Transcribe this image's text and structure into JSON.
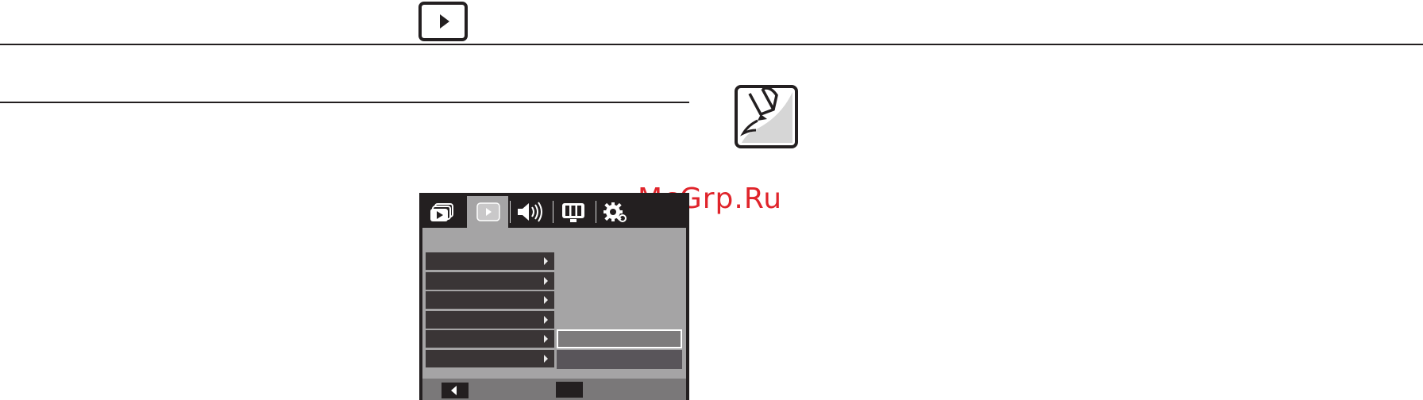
{
  "header": {
    "mode_icon": "play-icon"
  },
  "note": {
    "icon": "note-pencil-icon"
  },
  "watermark": {
    "text": "McGrp.Ru"
  },
  "camera_menu": {
    "tabs": [
      {
        "icon": "playback-album-icon",
        "selected": false
      },
      {
        "icon": "play-icon",
        "selected": true
      },
      {
        "icon": "sound-icon",
        "selected": false
      },
      {
        "icon": "display-icon",
        "selected": false
      },
      {
        "icon": "settings-gear-icon",
        "selected": false
      }
    ],
    "items": [
      {
        "label": ""
      },
      {
        "label": ""
      },
      {
        "label": ""
      },
      {
        "label": ""
      },
      {
        "label": ""
      },
      {
        "label": ""
      }
    ],
    "options": [
      {
        "label": "",
        "selected": true
      },
      {
        "label": "",
        "selected": false
      }
    ],
    "bottom": {
      "back_icon": "left-arrow-icon",
      "ok_label": ""
    }
  }
}
